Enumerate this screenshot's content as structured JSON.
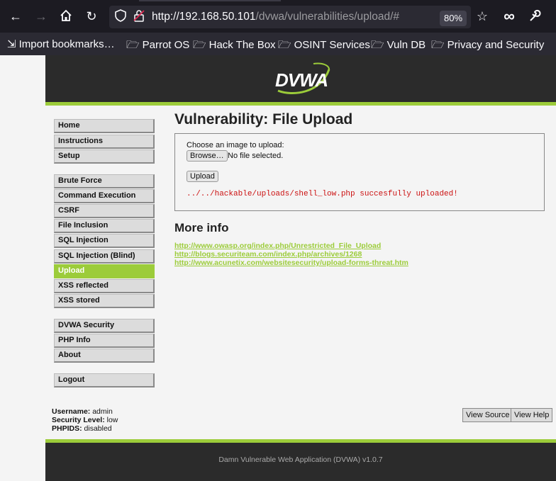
{
  "browser": {
    "url_host": "http://192.168.50.101",
    "url_path": "/dvwa/vulnerabilities/upload/#",
    "zoom": "80%",
    "icons": [
      "back-icon",
      "forward-icon",
      "home-icon",
      "reload-icon",
      "shield-icon",
      "lock-icon",
      "star-icon",
      "infinity-icon",
      "wrench-icon"
    ],
    "bookmarks": [
      {
        "label": "Import bookmarks…"
      },
      {
        "label": "Parrot OS"
      },
      {
        "label": "Hack The Box"
      },
      {
        "label": "OSINT Services"
      },
      {
        "label": "Vuln DB"
      },
      {
        "label": "Privacy and Security"
      }
    ]
  },
  "app": {
    "logo": "DVWA",
    "accent": "#9ccc3a",
    "menu_groups": [
      [
        {
          "label": "Home"
        },
        {
          "label": "Instructions"
        },
        {
          "label": "Setup"
        }
      ],
      [
        {
          "label": "Brute Force"
        },
        {
          "label": "Command Execution"
        },
        {
          "label": "CSRF"
        },
        {
          "label": "File Inclusion"
        },
        {
          "label": "SQL Injection"
        },
        {
          "label": "SQL Injection (Blind)"
        },
        {
          "label": "Upload"
        },
        {
          "label": "XSS reflected"
        },
        {
          "label": "XSS stored"
        }
      ],
      [
        {
          "label": "DVWA Security"
        },
        {
          "label": "PHP Info"
        },
        {
          "label": "About"
        }
      ],
      [
        {
          "label": "Logout"
        }
      ]
    ],
    "active_item": "Upload",
    "title": "Vulnerability: File Upload",
    "form": {
      "choose_label": "Choose an image to upload:",
      "browse_button": "Browse…",
      "no_file": "No file selected.",
      "upload_button": "Upload",
      "message": "../../hackable/uploads/shell_low.php succesfully uploaded!"
    },
    "more_info_title": "More info",
    "links": [
      "http://www.owasp.org/index.php/Unrestricted_File_Upload",
      "http://blogs.securiteam.com/index.php/archives/1268",
      "http://www.acunetix.com/websitesecurity/upload-forms-threat.htm"
    ],
    "user_info": {
      "username_label": "Username:",
      "username": "admin",
      "security_label": "Security Level:",
      "security": "low",
      "phpids_label": "PHPIDS:",
      "phpids": "disabled"
    },
    "view_source": "View Source",
    "view_help": "View Help",
    "footer": "Damn Vulnerable Web Application (DVWA) v1.0.7"
  }
}
